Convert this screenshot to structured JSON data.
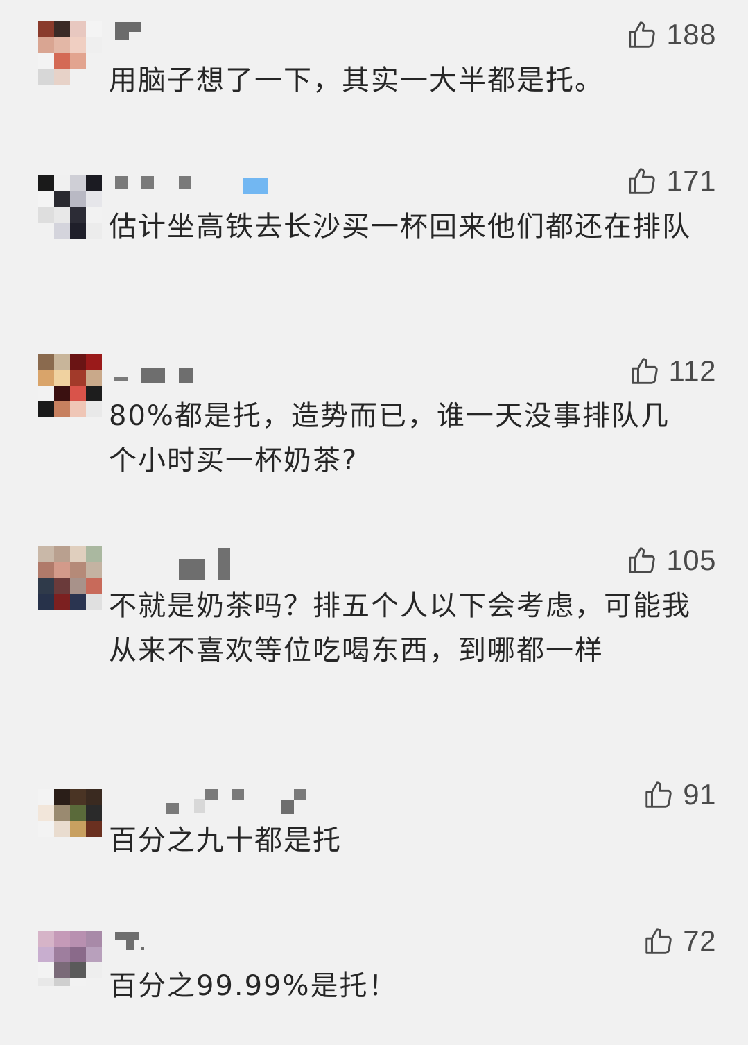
{
  "icons": {
    "like": "thumbs-up-icon"
  },
  "colors": {
    "background": "#f1f1f1",
    "text": "#262626",
    "like": "#4a4a4a"
  },
  "comments": [
    {
      "likes": "188",
      "text": "用脑子想了一下，其实一大半都是托。"
    },
    {
      "likes": "171",
      "text": "估计坐高铁去长沙买一杯回来他们都还在排队"
    },
    {
      "likes": "112",
      "text": "80%都是托，造势而已，谁一天没事排队几个小时买一杯奶茶?"
    },
    {
      "likes": "105",
      "text": "不就是奶茶吗？排五个人以下会考虑，可能我从来不喜欢等位吃喝东西，到哪都一样"
    },
    {
      "likes": "91",
      "text": "百分之九十都是托"
    },
    {
      "likes": "72",
      "text": "百分之99.99%是托！"
    }
  ]
}
